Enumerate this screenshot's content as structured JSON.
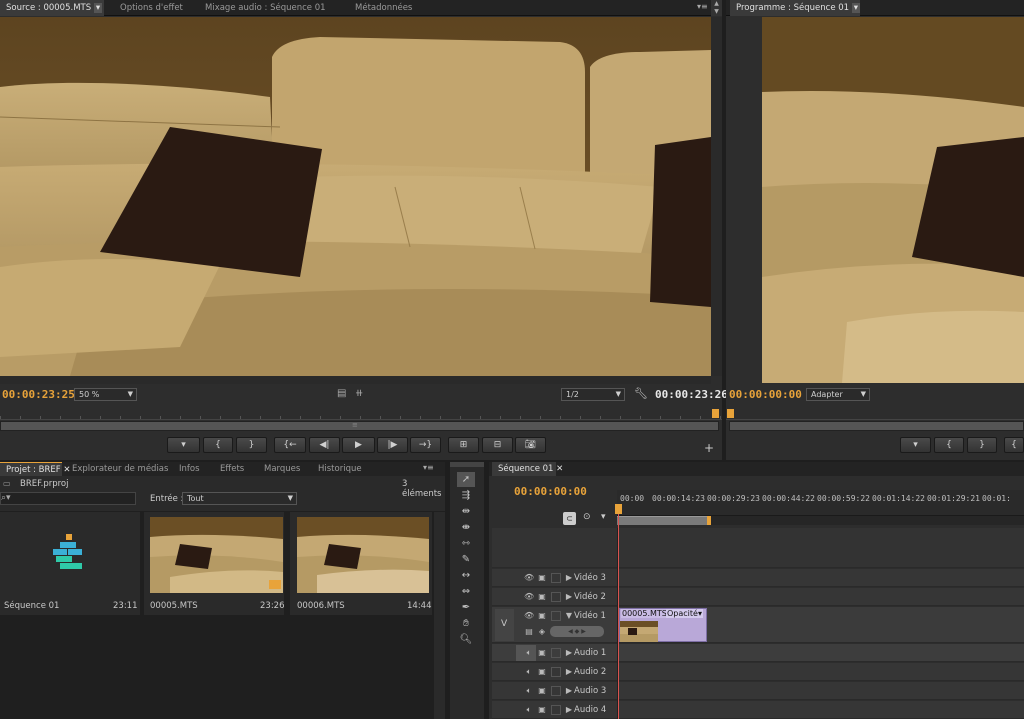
{
  "source_panel": {
    "tabs": [
      "Source : 00005.MTS",
      "Options d'effet",
      "Mixage audio : Séquence 01",
      "Métadonnées"
    ],
    "timecode_in": "00:00:23:25",
    "zoom": "50 %",
    "resolution": "1/2",
    "timecode_duration": "00:00:23:26"
  },
  "program_panel": {
    "tab": "Programme : Séquence 01",
    "timecode": "00:00:00:00",
    "fit": "Adapter"
  },
  "project_panel": {
    "tabs": [
      "Projet : BREF",
      "Explorateur de médias",
      "Infos",
      "Effets",
      "Marques",
      "Historique"
    ],
    "project_file": "BREF.prproj",
    "item_count": "3 éléments",
    "entry_label": "Entrée :",
    "entry_value": "Tout",
    "items": [
      {
        "name": "Séquence 01",
        "duration": "23:11"
      },
      {
        "name": "00005.MTS",
        "duration": "23:26"
      },
      {
        "name": "00006.MTS",
        "duration": "14:44"
      }
    ]
  },
  "timeline": {
    "tab": "Séquence 01",
    "timecode": "00:00:00:00",
    "ruler": [
      "00:00",
      "00:00:14:23",
      "00:00:29:23",
      "00:00:44:22",
      "00:00:59:22",
      "00:01:14:22",
      "00:01:29:21",
      "00:01:"
    ],
    "video_tracks": [
      "Vidéo 3",
      "Vidéo 2",
      "Vidéo 1"
    ],
    "audio_tracks": [
      "Audio 1",
      "Audio 2",
      "Audio 3",
      "Audio 4"
    ],
    "v_label": "V",
    "clip_name": "00005.MTS",
    "clip_effect": "Opacité"
  },
  "colors": {
    "accent_orange": "#e8a33a",
    "clip_purple": "#b9a8d8",
    "playhead": "#d9534f"
  }
}
